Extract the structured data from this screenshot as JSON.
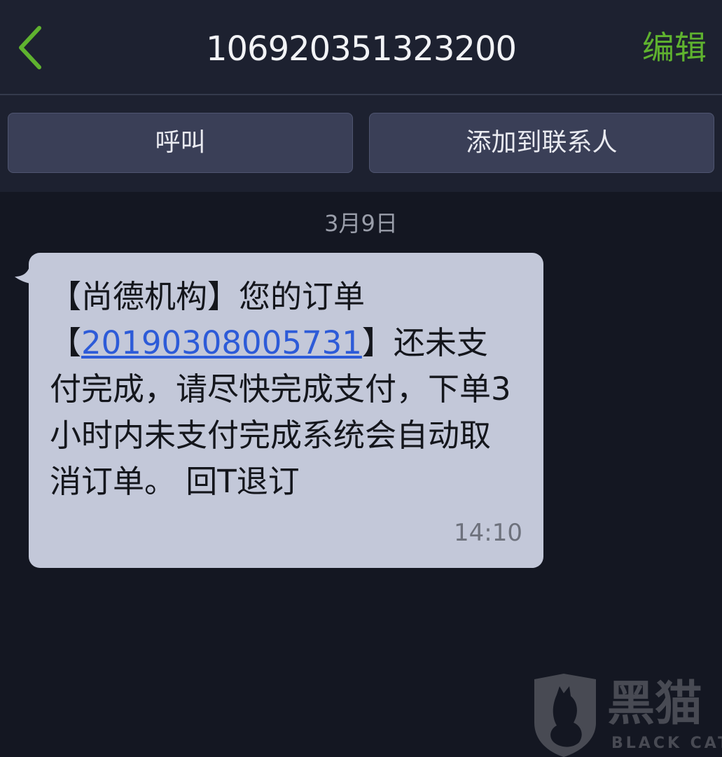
{
  "header": {
    "back_icon": "chevron-left-icon",
    "title": "106920351323200",
    "edit_label": "编辑",
    "accent_color": "#5fb22f"
  },
  "actions": {
    "call_label": "呼叫",
    "add_contact_label": "添加到联系人"
  },
  "conversation": {
    "date": "3月9日",
    "message": {
      "text_before_link": "【尚德机构】您的订单【",
      "link": "20190308005731",
      "text_after_link": "】还未支付完成，请尽快完成支付，下单3小时内未支付完成系统会自动取消订单。 回T退订",
      "time": "14:10"
    }
  },
  "watermark": {
    "text": "黑猫",
    "subtext": "BLACK CAT",
    "icon": "black-cat-logo-icon"
  }
}
